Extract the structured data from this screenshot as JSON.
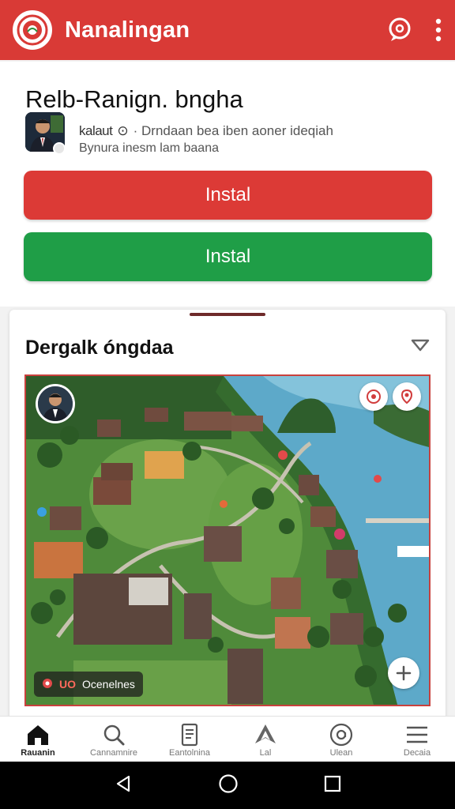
{
  "app": {
    "title": "Nanalingan"
  },
  "header": {
    "title": "Relb-Ranign. bngha",
    "author": "kalaut",
    "author_suffix": "⊙",
    "description": "· Drndaan bea iben aoner ideqiah",
    "subline": "Bynura inesm lam baana"
  },
  "actions": {
    "primary_label": "Instal",
    "secondary_label": "Instal"
  },
  "map_section": {
    "title": "Dergalk óngdaa",
    "legend_code": "UO",
    "legend_label": "Ocenelnes"
  },
  "bottom_nav": {
    "items": [
      {
        "label": "Rauanin",
        "icon": "home-icon",
        "active": true
      },
      {
        "label": "Cannamnire",
        "icon": "search-icon",
        "active": false
      },
      {
        "label": "Eantolnina",
        "icon": "document-icon",
        "active": false
      },
      {
        "label": "Lal",
        "icon": "navigation-icon",
        "active": false
      },
      {
        "label": "Ulean",
        "icon": "at-icon",
        "active": false
      },
      {
        "label": "Decaia",
        "icon": "menu-icon",
        "active": false
      }
    ]
  },
  "colors": {
    "brand_red": "#d93a36",
    "install_red": "#dc3a36",
    "install_green": "#1f9e47"
  }
}
